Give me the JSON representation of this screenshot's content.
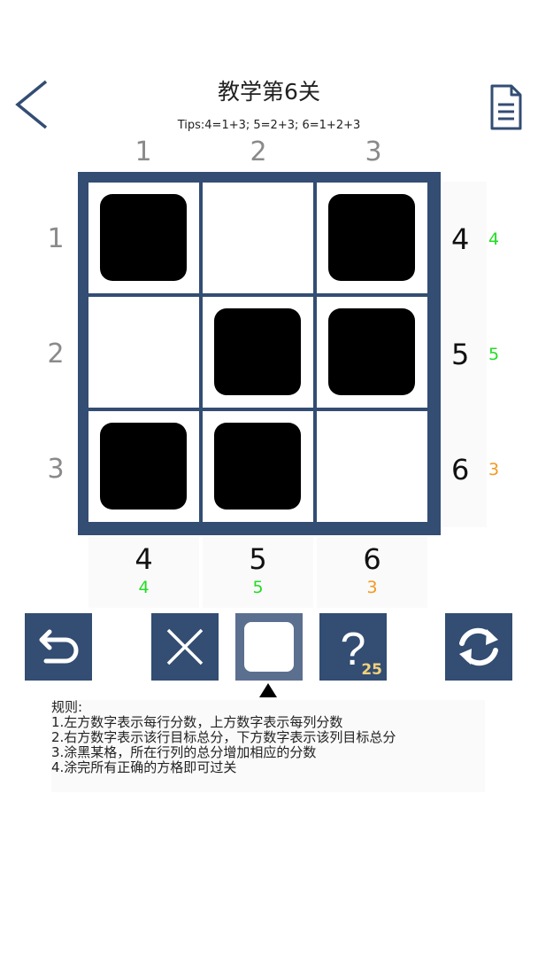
{
  "header": {
    "title": "教学第6关",
    "tips": "Tips:4=1+3;  5=2+3;  6=1+2+3"
  },
  "colors": {
    "board": "#334d73",
    "correct": "#22dd22",
    "incorrect": "#f39a20"
  },
  "board": {
    "column_numbers": [
      "1",
      "2",
      "3"
    ],
    "row_numbers": [
      "1",
      "2",
      "3"
    ],
    "cells": [
      [
        true,
        false,
        true
      ],
      [
        false,
        true,
        true
      ],
      [
        true,
        true,
        false
      ]
    ]
  },
  "row_targets": [
    {
      "target": "4",
      "current": "4",
      "status": "correct"
    },
    {
      "target": "5",
      "current": "5",
      "status": "correct"
    },
    {
      "target": "6",
      "current": "3",
      "status": "incorrect"
    }
  ],
  "col_targets": [
    {
      "target": "4",
      "current": "4",
      "status": "correct"
    },
    {
      "target": "5",
      "current": "5",
      "status": "correct"
    },
    {
      "target": "6",
      "current": "3",
      "status": "incorrect"
    }
  ],
  "toolbar": {
    "undo_icon": "undo-icon",
    "cross_icon": "cross-icon",
    "blank_icon": "blank-square-icon",
    "help_icon": "question-icon",
    "help_count": "25",
    "refresh_icon": "refresh-icon",
    "selected_tool": "blank"
  },
  "rules": {
    "heading": "规则:",
    "items": [
      "1.左方数字表示每行分数，上方数字表示每列分数",
      "2.右方数字表示该行目标总分，下方数字表示该列目标总分",
      "3.涂黑某格，所在行列的总分增加相应的分数",
      "4.涂完所有正确的方格即可过关"
    ]
  }
}
